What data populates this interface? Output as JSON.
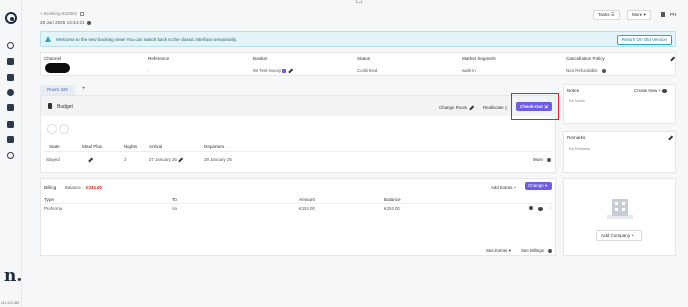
{
  "booking": {
    "id_label": "< Booking 832892",
    "created": "28 Jan 2025 13:44:21"
  },
  "header": {
    "tasks_label": "Tasks",
    "more_label": "More",
    "user_initials": "PH"
  },
  "banner": {
    "message": "Welcome to the new booking view! You can switch back to the classic interface temporarily.",
    "button_label": "Return On Old Version"
  },
  "summary": {
    "headers": [
      "Channel",
      "Reference",
      "Booker",
      "Status",
      "Market Segment",
      "Cancellation Policy"
    ],
    "values": {
      "reference": "-",
      "booker": "Mr Test Noooy",
      "status": "Confirmed",
      "market_segment": "walk-in",
      "cancellation_policy": "Non Refundable"
    }
  },
  "room": {
    "tab_label": "Room 420",
    "add_tab": "+",
    "name": "Budget",
    "change_room_label": "Change Room",
    "reallocate_label": "Reallocate",
    "checkout_label": "Check-Out",
    "stay_headers": [
      "State",
      "Meal Plan",
      "Nights",
      "Arrival",
      "Departure"
    ],
    "stay": {
      "state": "Stayed",
      "nights": "2",
      "arrival": "27 January 25",
      "departure": "29 January 25",
      "more_label": "More"
    }
  },
  "billing": {
    "tabs": [
      "Billing",
      "Balance"
    ],
    "balance_value": "€334.00",
    "add_extras_label": "Add Extras",
    "change_label": "Change",
    "headers": [
      "Type",
      "To",
      "Amount",
      "Balance"
    ],
    "row": {
      "type": "Proforma",
      "to": "na",
      "amount": "€334.00",
      "balance": "€334.00"
    },
    "see_extras_label": "See Extras",
    "see_billings_label": "See Billings"
  },
  "notes": {
    "title": "Notes",
    "create_label": "Create New",
    "empty": "No Notes"
  },
  "remarks": {
    "title": "Remarks",
    "empty": "No Remarks"
  },
  "company": {
    "add_label": "Add Company"
  },
  "sidebar": {
    "brand": "n.",
    "version": "v11.9.0-487"
  },
  "colors": {
    "accent": "#6c5ce7",
    "highlight": "#e02020",
    "banner_bg": "#e3f4f8",
    "balance_red": "#e02020"
  }
}
